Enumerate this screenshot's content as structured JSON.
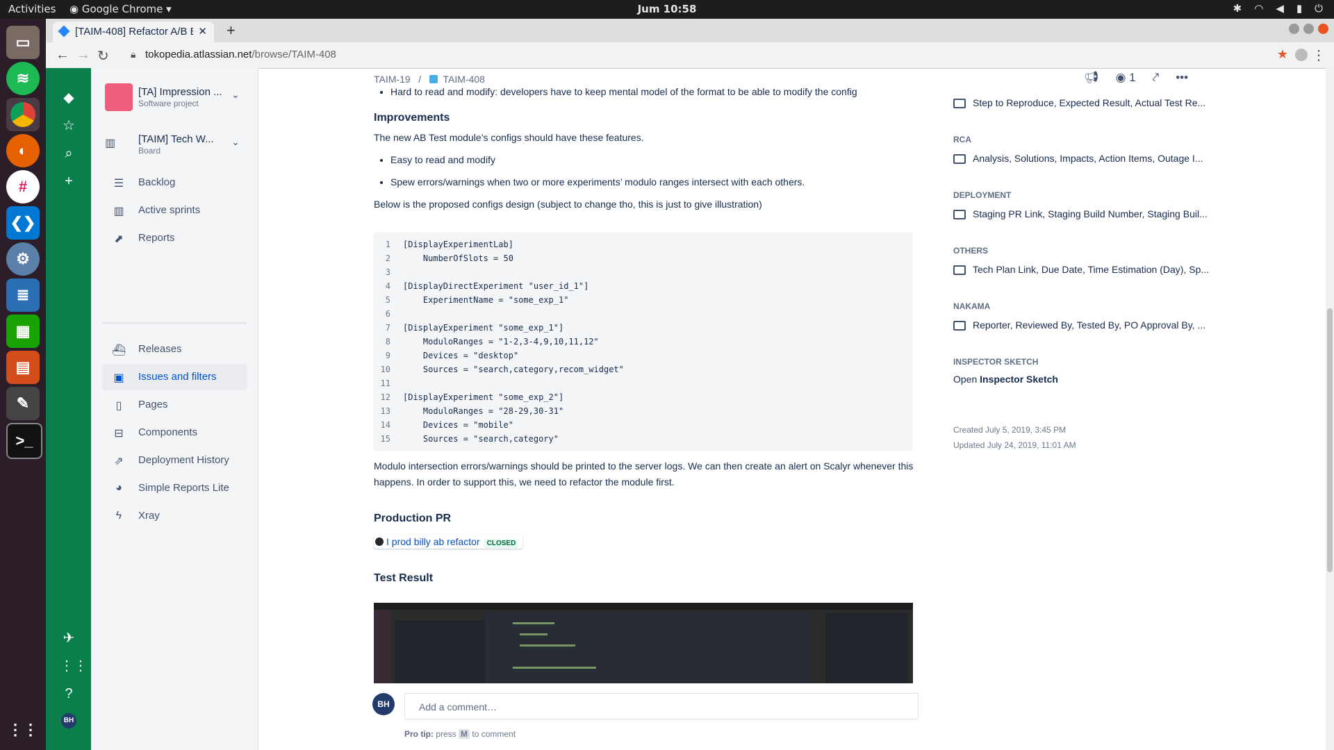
{
  "system": {
    "activities": "Activities",
    "app_menu": "Google Chrome",
    "clock": "Jum 10:58"
  },
  "browser": {
    "tab_title": "[TAIM-408] Refactor A/B E",
    "url_host": "tokopedia.atlassian.net",
    "url_path": "/browse/TAIM-408"
  },
  "global_nav": {
    "avatar": "BH"
  },
  "project_nav": {
    "project_name": "[TA] Impression ...",
    "project_type": "Software project",
    "board_name": "[TAIM] Tech W...",
    "board_type": "Board",
    "items_top": [
      {
        "label": "Backlog",
        "icon": "backlog-icon"
      },
      {
        "label": "Active sprints",
        "icon": "board-icon"
      },
      {
        "label": "Reports",
        "icon": "chart-icon"
      }
    ],
    "items_bottom": [
      {
        "label": "Releases",
        "icon": "ship-icon"
      },
      {
        "label": "Issues and filters",
        "icon": "issues-icon",
        "active": true
      },
      {
        "label": "Pages",
        "icon": "page-icon"
      },
      {
        "label": "Components",
        "icon": "component-icon"
      },
      {
        "label": "Deployment History",
        "icon": "external-link-icon"
      },
      {
        "label": "Simple Reports Lite",
        "icon": "pie-icon"
      },
      {
        "label": "Xray",
        "icon": "bolt-icon"
      }
    ]
  },
  "issue": {
    "parent_key": "TAIM-19",
    "key": "TAIM-408",
    "watch_count": "1",
    "bullet_hard": "Hard to read and modify: developers have to keep mental model of the format to be able to modify the config",
    "improvements_heading": "Improvements",
    "improvements_intro": "The new AB Test module’s configs should have these features.",
    "improvements": [
      "Easy to read and modify",
      "Spew errors/warnings when two or more experiments’ modulo ranges intersect with each others."
    ],
    "proposal_intro": "Below is the proposed configs design (subject to change tho, this is just to give illustration)",
    "code_lines": [
      "[DisplayExperimentLab]",
      "    NumberOfSlots = 50",
      "",
      "[DisplayDirectExperiment \"user_id_1\"]",
      "    ExperimentName = \"some_exp_1\"",
      "",
      "[DisplayExperiment \"some_exp_1\"]",
      "    ModuloRanges = \"1-2,3-4,9,10,11,12\"",
      "    Devices = \"desktop\"",
      "    Sources = \"search,category,recom_widget\"",
      "",
      "[DisplayExperiment \"some_exp_2\"]",
      "    ModuloRanges = \"28-29,30-31\"",
      "    Devices = \"mobile\"",
      "    Sources = \"search,category\""
    ],
    "after_code": "Modulo intersection errors/warnings should be printed to the server logs. We can then create an alert on Scalyr whenever this happens. In order to support this, we need to refactor the module first.",
    "production_pr_heading": "Production PR",
    "pr_link": "I prod billy ab refactor",
    "pr_status": "CLOSED",
    "test_result_heading": "Test Result"
  },
  "sidebar": {
    "first_field": "Step to Reproduce, Expected Result, Actual Test Re...",
    "groups": [
      {
        "label": "RCA",
        "value": "Analysis, Solutions, Impacts, Action Items, Outage I..."
      },
      {
        "label": "DEPLOYMENT",
        "value": "Staging PR Link, Staging Build Number, Staging Buil..."
      },
      {
        "label": "OTHERS",
        "value": "Tech Plan Link, Due Date, Time Estimation (Day), Sp..."
      },
      {
        "label": "NAKAMA",
        "value": "Reporter, Reviewed By, Tested By, PO Approval By, ..."
      }
    ],
    "inspector_label": "INSPECTOR SKETCH",
    "inspector_open": "Open",
    "inspector_link": "Inspector Sketch",
    "created": "Created July 5, 2019, 3:45 PM",
    "updated": "Updated July 24, 2019, 11:01 AM"
  },
  "comment": {
    "avatar": "BH",
    "placeholder": "Add a comment…",
    "tip_bold": "Pro tip:",
    "tip_press": "press",
    "tip_key": "M",
    "tip_rest": "to comment"
  },
  "colors": {
    "global_nav": "#0a7f4b",
    "link": "#0052cc",
    "dock": "#2c1e29"
  }
}
